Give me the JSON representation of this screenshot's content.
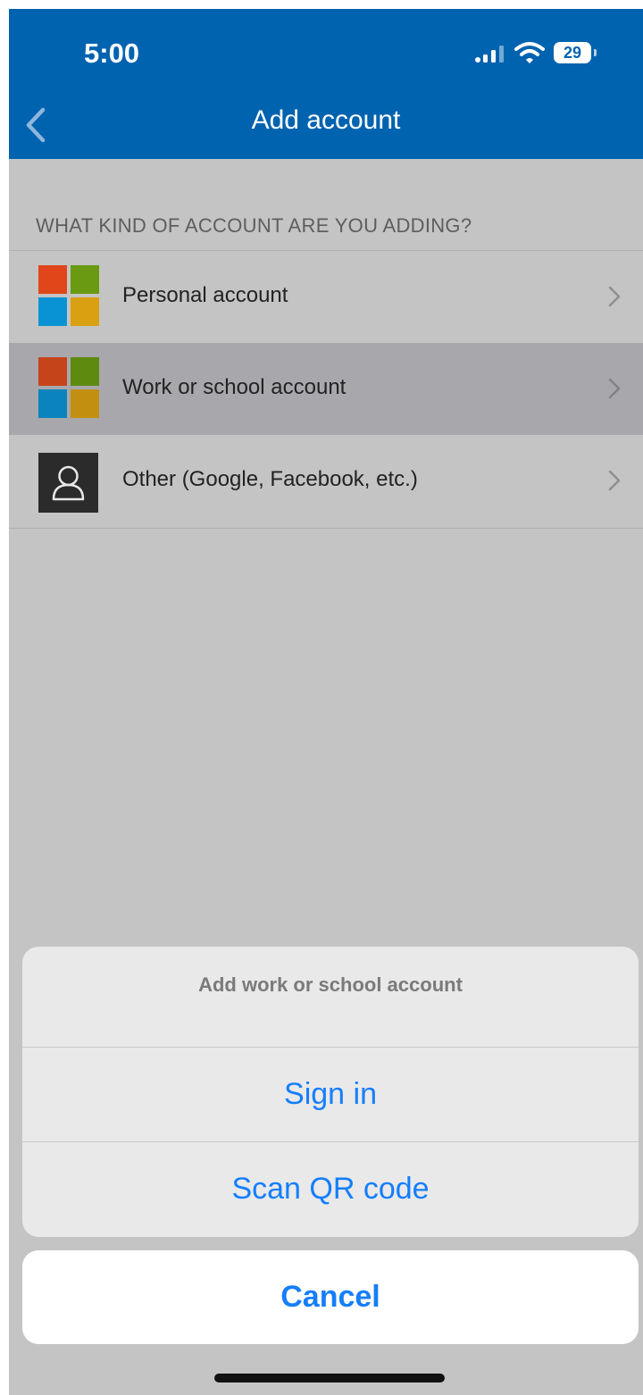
{
  "status_bar": {
    "time": "5:00",
    "battery_level": "29"
  },
  "nav": {
    "title": "Add account",
    "back_icon": "chevron-left-icon"
  },
  "list": {
    "section_header": "WHAT KIND OF ACCOUNT ARE YOU ADDING?",
    "items": [
      {
        "label": "Personal account",
        "icon": "microsoft-logo-icon",
        "highlighted": false
      },
      {
        "label": "Work or school account",
        "icon": "microsoft-logo-icon",
        "highlighted": true
      },
      {
        "label": "Other (Google, Facebook, etc.)",
        "icon": "person-icon",
        "highlighted": false
      }
    ]
  },
  "action_sheet": {
    "title": "Add work or school account",
    "actions": [
      {
        "label": "Sign in"
      },
      {
        "label": "Scan QR code"
      }
    ],
    "cancel_label": "Cancel"
  },
  "colors": {
    "nav_background": "#0063af",
    "accent": "#157efb",
    "microsoft_red": "#f25022",
    "microsoft_green": "#7fba00",
    "microsoft_blue": "#00a4ef",
    "microsoft_yellow": "#ffb900"
  }
}
